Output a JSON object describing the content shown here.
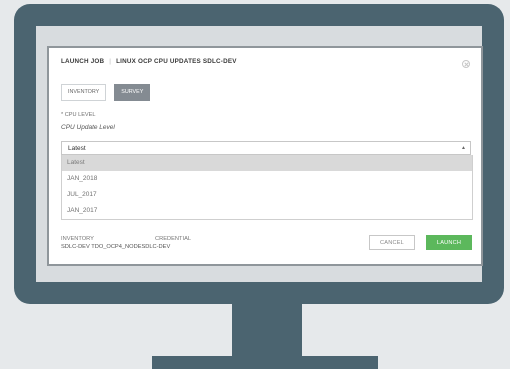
{
  "modal": {
    "title_left": "LAUNCH JOB",
    "title_sep": "|",
    "title_right": "LINUX OCP CPU UPDATES SDLC-DEV",
    "tabs": [
      {
        "label": "INVENTORY",
        "active": false
      },
      {
        "label": "SURVEY",
        "active": true
      }
    ],
    "field": {
      "label": "* CPU LEVEL",
      "question": "CPU Update Level",
      "selected": "Latest",
      "options": [
        "Latest",
        "JAN_2018",
        "JUL_2017",
        "JAN_2017"
      ]
    },
    "summary": {
      "inventory_label": "INVENTORY",
      "credential_label": "CREDENTIAL",
      "values_text": "SDLC-DEV TDO_OCP4_NODESDLC-DEV"
    },
    "buttons": {
      "cancel": "CANCEL",
      "launch": "LAUNCH"
    }
  },
  "icons": {
    "close": "close-icon",
    "dropdown": "caret-up-icon"
  },
  "colors": {
    "monitor": "#4b6470",
    "launch_button": "#5cb85c",
    "active_tab": "#848b92"
  }
}
